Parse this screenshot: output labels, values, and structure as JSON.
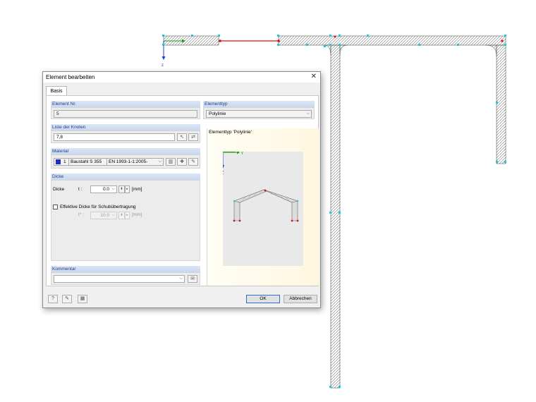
{
  "canvas": {
    "axis_z_label": "z"
  },
  "dialog": {
    "title": "Element bearbeiten",
    "close_glyph": "✕",
    "tabs": [
      "Basis"
    ],
    "element_nr": {
      "header": "Element Nr.",
      "value": "5"
    },
    "elementtyp": {
      "header": "Elementtyp",
      "value": "Polylinie"
    },
    "knoten": {
      "header": "Liste der Knoten",
      "value": "7,8"
    },
    "material": {
      "header": "Material",
      "number": "1",
      "name": "Baustahl S 355",
      "norm": "EN 1993-1-1:2005-",
      "color": "#1a2fbf"
    },
    "dicke": {
      "header": "Dicke",
      "label": "Dicke",
      "symbol": "t :",
      "value": "0.0",
      "unit": "[mm]",
      "effective_label": "Effektive Dicke für Schubübertragung",
      "effective_symbol": "t* :",
      "effective_value": "10.0",
      "effective_unit": "[mm]",
      "effective_checked": false
    },
    "kommentar": {
      "header": "Kommentar",
      "value": ""
    },
    "preview": {
      "title": "Elementtyp 'Polylinie'",
      "axis_y": "Y",
      "axis_z": "Z"
    },
    "buttons": {
      "ok": "OK",
      "cancel": "Abbrechen"
    },
    "icons": [
      "help-icon",
      "edit-icon",
      "units-icon",
      "pick-nodes-icon",
      "reverse-icon",
      "library-icon",
      "new-material-icon",
      "edit-material-icon",
      "comment-icon"
    ]
  }
}
